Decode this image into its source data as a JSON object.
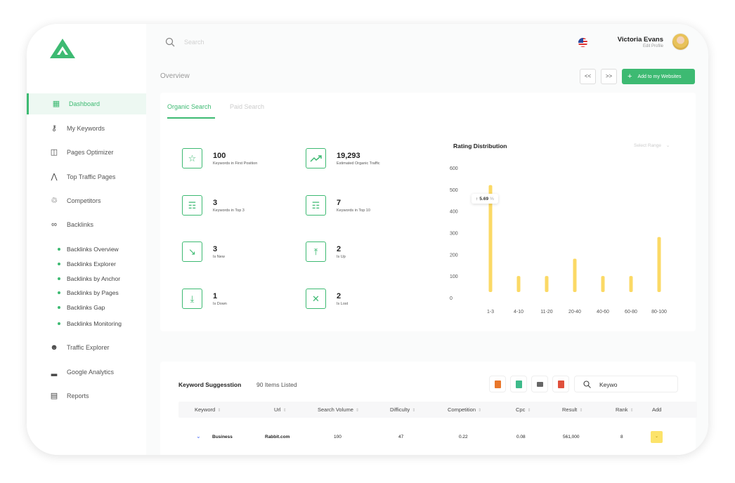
{
  "header": {
    "search_placeholder": "Search",
    "user_name": "Victoria Evans",
    "user_sub": "Edit Profile"
  },
  "sidebar": {
    "items": [
      {
        "label": "Dashboard",
        "icon": "grid-icon",
        "active": true
      },
      {
        "label": "My Keywords",
        "icon": "key-icon"
      },
      {
        "label": "Pages Optimizer",
        "icon": "document-icon"
      },
      {
        "label": "Top Traffic Pages",
        "icon": "tree-icon"
      },
      {
        "label": "Competitors",
        "icon": "trophy-icon"
      },
      {
        "label": "Backlinks",
        "icon": "link-icon"
      }
    ],
    "backlinks_sub": [
      "Backlinks Overview",
      "Backlinks Explorer",
      "Backlinks by Anchor",
      "Backlinks by Pages",
      "Backlinks Gap",
      "Backlinks Monitoring"
    ],
    "items_bottom": [
      {
        "label": "Traffic Explorer",
        "icon": "people-icon"
      },
      {
        "label": "Google Analytics",
        "icon": "bar-chart-icon"
      },
      {
        "label": "Reports",
        "icon": "clipboard-icon"
      }
    ]
  },
  "page": {
    "title": "Overview",
    "prev_label": "<<",
    "next_label": ">>",
    "add_button": "Add to my Websites"
  },
  "tabs": [
    {
      "label": "Organic Search",
      "active": true
    },
    {
      "label": "Paid Search",
      "active": false
    }
  ],
  "stats": [
    {
      "value": "100",
      "label": "Keywords in First Position",
      "icon": "star-icon"
    },
    {
      "value": "19,293",
      "label": "Estimated Organic Traffic",
      "icon": "trend-up-icon"
    },
    {
      "value": "3",
      "label": "Keywords in Top 3",
      "icon": "badge-icon"
    },
    {
      "value": "7",
      "label": "Keywords in Top 10",
      "icon": "badge-icon"
    },
    {
      "value": "3",
      "label": "Is New",
      "icon": "arrow-down-right-icon"
    },
    {
      "value": "2",
      "label": "Is Up",
      "icon": "upload-icon"
    },
    {
      "value": "1",
      "label": "Is Down",
      "icon": "download-icon"
    },
    {
      "value": "2",
      "label": "Is Lost",
      "icon": "x-icon"
    }
  ],
  "chart_data": {
    "type": "bar",
    "title": "Rating Distribution",
    "select_label": "Select Range",
    "categories": [
      "1-3",
      "4-10",
      "11-20",
      "20-40",
      "40-60",
      "60-80",
      "80-100"
    ],
    "values": [
      520,
      100,
      100,
      180,
      100,
      100,
      280
    ],
    "y_ticks": [
      "0",
      "100",
      "200",
      "300",
      "400",
      "500",
      "600"
    ],
    "ylim": [
      0,
      600
    ],
    "tooltip": "5.69",
    "tooltip_unit": "%",
    "bar_color": "#fbd965",
    "grid": false
  },
  "table": {
    "title": "Keyword Suggesstion",
    "count": "90 Items Listed",
    "search_value": "Keywo",
    "export_colors": [
      "#e9772b",
      "#3dba8a",
      "#666666",
      "#e0503c"
    ],
    "columns": [
      "Keyword",
      "Url",
      "Search Volume",
      "Difficulty",
      "Competition",
      "Cpc",
      "Result",
      "Rank",
      "Add"
    ],
    "rows": [
      {
        "keyword": "Business",
        "url": "Rabbit.com",
        "volume": "100",
        "difficulty": "47",
        "competition": "0.22",
        "cpc": "0.08",
        "result": "561,000",
        "rank": "8"
      }
    ]
  },
  "colors": {
    "accent": "#3dba72",
    "bar": "#fbd965"
  }
}
